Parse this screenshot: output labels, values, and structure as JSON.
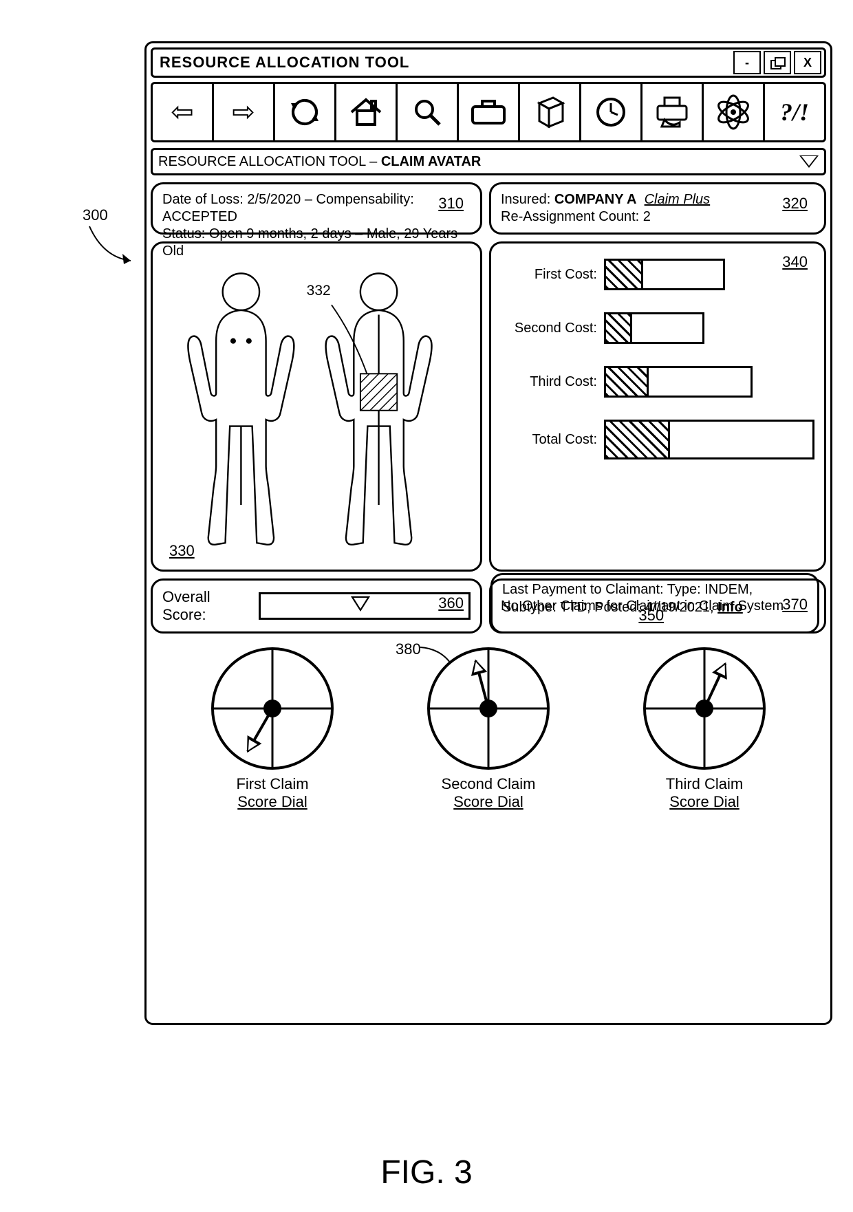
{
  "figure_label": "FIG. 3",
  "figure_ref": "300",
  "window": {
    "title": "RESOURCE ALLOCATION TOOL",
    "minimize": "-",
    "restore": "restore-icon",
    "close": "X"
  },
  "toolbar": {
    "back_icon": "⇦",
    "forward_icon": "⇨",
    "refresh_icon": "⟳",
    "home_icon": "⌂",
    "search_icon": "🔍",
    "briefcase_icon": "briefcase",
    "book_icon": "book",
    "clock_icon": "clock",
    "printer_icon": "printer",
    "atom_icon": "atom",
    "help_label": "?/!"
  },
  "subheader": {
    "prefix": "RESOURCE ALLOCATION TOOL – ",
    "bold": "CLAIM AVATAR"
  },
  "panels": {
    "p310": {
      "ref": "310",
      "line1_a": "Date of Loss: ",
      "line1_b": "2/5/2020",
      "line1_c": " – Compensability: ",
      "line1_d": "ACCEPTED",
      "line2": "Status: Open 9 months, 2 days – Male, 29 Years Old"
    },
    "p320": {
      "ref": "320",
      "insured_label": "Insured: ",
      "company": "COMPANY A",
      "claimplus": "Claim Plus",
      "reassign": "Re-Assignment Count: 2"
    },
    "p330": {
      "ref": "330",
      "callout": "332"
    },
    "p340": {
      "ref": "340"
    },
    "p350": {
      "ref": "350",
      "text": "Last Payment to Claimant:  Type: INDEM, Subtype: TTD, Posted: 4//19/2021, ",
      "info": "Info"
    },
    "p360": {
      "ref": "360",
      "label": "Overall Score:",
      "value_pct": 50
    },
    "p370": {
      "ref": "370",
      "text": "No Other Claims for Claimant in Claim System"
    }
  },
  "chart_data": {
    "type": "bar",
    "title": "",
    "xlabel": "",
    "ylabel": "",
    "categories": [
      "First Cost:",
      "Second Cost:",
      "Third Cost:",
      "Total Cost:"
    ],
    "series": [
      {
        "name": "filled",
        "values": [
          30,
          25,
          28,
          30
        ]
      },
      {
        "name": "total_width_pct",
        "values": [
          55,
          45,
          68,
          100
        ]
      }
    ]
  },
  "dials": {
    "callout380": "380",
    "items": [
      {
        "label1": "First Claim",
        "label2": "Score Dial",
        "angle": 30
      },
      {
        "label1": "Second Claim",
        "label2": "Score Dial",
        "angle": 165
      },
      {
        "label1": "Third Claim",
        "label2": "Score Dial",
        "angle": 205
      }
    ]
  }
}
